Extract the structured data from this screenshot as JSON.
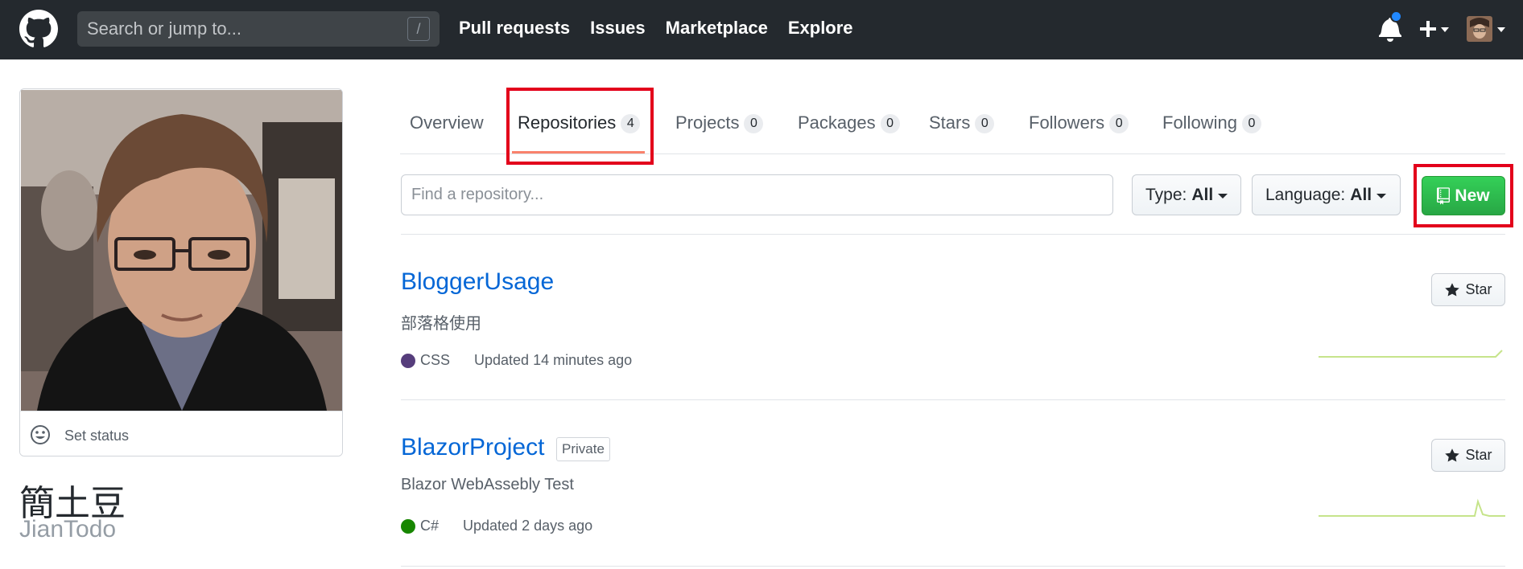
{
  "header": {
    "search_placeholder": "Search or jump to...",
    "search_shortcut": "/",
    "nav": [
      "Pull requests",
      "Issues",
      "Marketplace",
      "Explore"
    ],
    "has_notification": true
  },
  "profile": {
    "set_status": "Set status",
    "full_name": "簡土豆",
    "login": "JianTodo"
  },
  "tabs": [
    {
      "label": "Overview"
    },
    {
      "label": "Repositories",
      "count": "4",
      "selected": true
    },
    {
      "label": "Projects",
      "count": "0"
    },
    {
      "label": "Packages",
      "count": "0"
    },
    {
      "label": "Stars",
      "count": "0"
    },
    {
      "label": "Followers",
      "count": "0"
    },
    {
      "label": "Following",
      "count": "0"
    }
  ],
  "filters": {
    "find_placeholder": "Find a repository...",
    "type_label": "Type:",
    "type_value": "All",
    "language_label": "Language:",
    "language_value": "All",
    "new_label": "New"
  },
  "repos": [
    {
      "name": "BloggerUsage",
      "description": "部落格使用",
      "language": "CSS",
      "language_color": "#563d7c",
      "updated": "Updated 14 minutes ago",
      "star_label": "Star"
    },
    {
      "name": "BlazorProject",
      "private_label": "Private",
      "description": "Blazor WebAssebly Test",
      "language": "C#",
      "language_color": "#178600",
      "updated": "Updated 2 days ago",
      "star_label": "Star"
    }
  ],
  "colors": {
    "header_bg": "#24292e",
    "link": "#0366d6",
    "primary_green": "#28a745",
    "highlight_box": "#e3001b",
    "tab_underline": "#f9826c"
  }
}
